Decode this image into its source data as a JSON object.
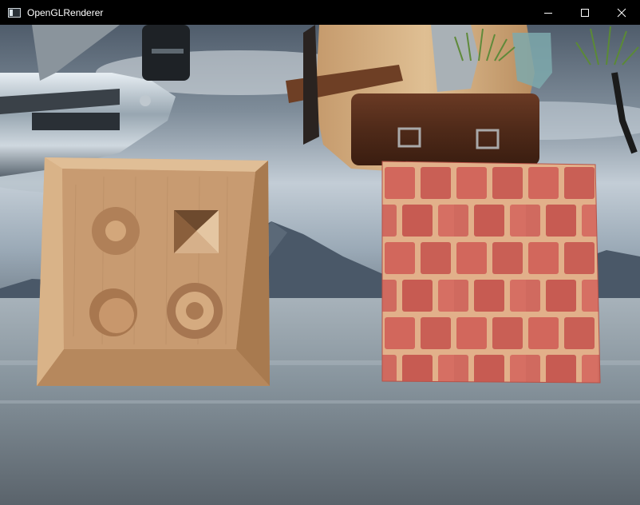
{
  "window": {
    "title": "OpenGLRenderer",
    "controls": {
      "minimize": "—",
      "maximize": "□",
      "close": "✕"
    }
  },
  "scene": {
    "background": "sky-and-lake-skybox",
    "objects": [
      {
        "name": "metal-backpack-model-left"
      },
      {
        "name": "leather-backpack-model-right"
      },
      {
        "name": "grass-billboard-top-middle"
      },
      {
        "name": "grass-billboard-top-right"
      },
      {
        "name": "wood-parallax-quad",
        "texture": "wood-relief-with-circles-and-pyramid"
      },
      {
        "name": "brick-parallax-quad",
        "texture": "red-brick-wall"
      }
    ],
    "colors": {
      "sky_top": "#4d5a68",
      "sky_mid": "#b9c4ce",
      "water": "#6b7880",
      "wood": "#c89b71",
      "brick": "#d76b5f",
      "mortar": "#e6b794"
    }
  }
}
